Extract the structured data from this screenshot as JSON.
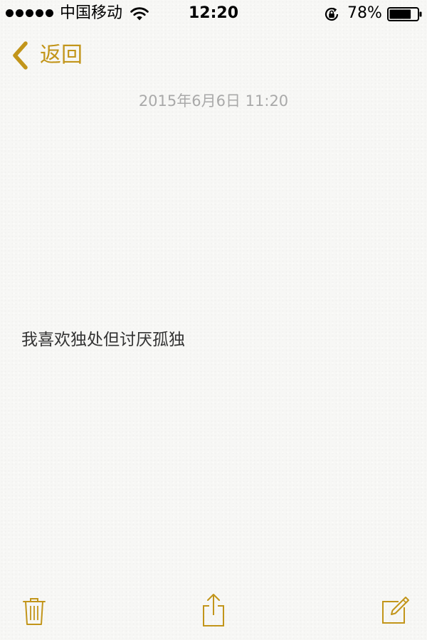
{
  "status_bar": {
    "carrier": "中国移动",
    "time": "12:20",
    "battery_percent": "78%",
    "battery_level": 0.78,
    "signal_bars": 5,
    "icons": [
      "signal-dots-icon",
      "wifi-icon",
      "rotation-lock-icon",
      "battery-icon"
    ]
  },
  "nav": {
    "back_label": "返回",
    "back_icon": "chevron-left-icon"
  },
  "note": {
    "date": "2015年6月6日 11:20",
    "body": "我喜欢独处但讨厌孤独"
  },
  "toolbar": {
    "icons": [
      "trash-icon",
      "share-icon",
      "compose-icon"
    ]
  },
  "colors": {
    "accent": "#c2951a",
    "date_text": "#a9a9a9",
    "body_text": "#333333",
    "paper": "#f7f7f5"
  }
}
